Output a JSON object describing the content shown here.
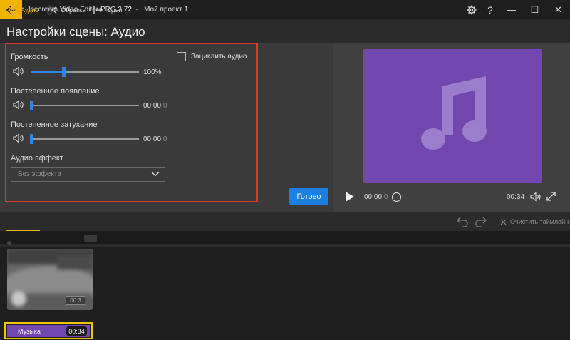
{
  "window": {
    "title": "Icecream Video Editor PRO 2.72  -   Мой проект 1",
    "settings_icon": "gear-icon",
    "help_label": "?",
    "minimize_label": "—",
    "maximize_label": "☐",
    "close_label": "✕"
  },
  "page": {
    "title": "Настройки сцены: Аудио"
  },
  "settings": {
    "volume": {
      "label": "Громкость",
      "value": "100%",
      "level": 0.3
    },
    "loop": {
      "label": "Зациклить аудио",
      "checked": false
    },
    "fade_in": {
      "label": "Постепенное появление",
      "value": "00:00.",
      "value_dim": "0",
      "level": 0.0
    },
    "fade_out": {
      "label": "Постепенное затухание",
      "value": "00:00.",
      "value_dim": "0",
      "level": 0.0
    },
    "effect": {
      "label": "Аудио эффект",
      "selected": "Без эффекта"
    },
    "done_label": "Готово"
  },
  "preview": {
    "time_current": "00:00.",
    "time_current_dim": "0",
    "time_total": "00:34",
    "progress": 0.0,
    "canvas_color": "#7347b0"
  },
  "toolbar": {
    "tabs": [
      {
        "label": "Аудио",
        "icon": "gear-icon",
        "active": true
      },
      {
        "label": "Обрезка",
        "icon": "scissors-icon",
        "active": false
      },
      {
        "label": "Сдвиг",
        "icon": "shift-icon",
        "active": false
      }
    ],
    "clear_label": "Очистить таймлайн"
  },
  "timeline": {
    "video_clip_duration": "00:3",
    "audio_clip": {
      "label": "Музыка",
      "duration": "00:34",
      "color": "#7347b0"
    }
  },
  "colors": {
    "accent": "#f0b400",
    "primary_button": "#1d7fe0",
    "highlight_border": "#e03a24"
  }
}
